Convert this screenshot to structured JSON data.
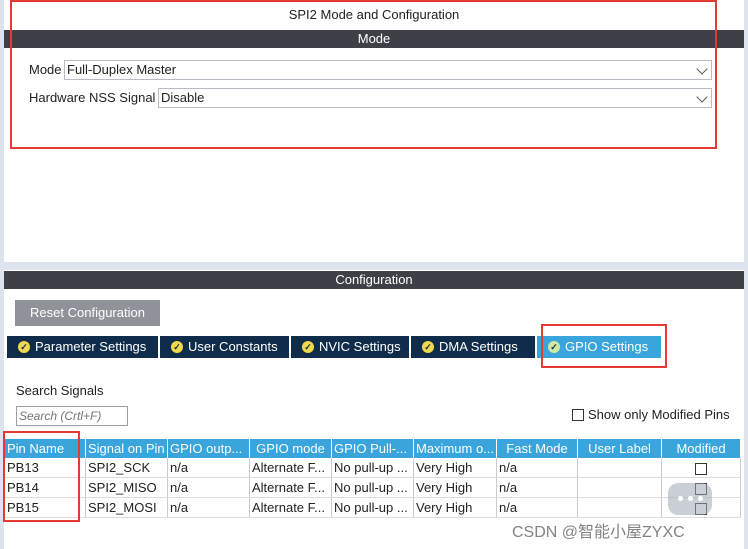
{
  "window": {
    "title": "SPI2 Mode and Configuration"
  },
  "mode_section": {
    "header": "Mode",
    "mode_label": "Mode",
    "mode_value": "Full-Duplex Master",
    "nss_label": "Hardware NSS Signal",
    "nss_value": "Disable"
  },
  "config_section": {
    "header": "Configuration",
    "reset_button": "Reset Configuration",
    "tabs": [
      {
        "label": "Parameter Settings"
      },
      {
        "label": "User Constants"
      },
      {
        "label": "NVIC Settings"
      },
      {
        "label": "DMA Settings"
      },
      {
        "label": "GPIO Settings",
        "active": true
      }
    ],
    "search_label": "Search Signals",
    "search_placeholder": "Search (Crtl+F)",
    "show_modified_label": "Show only Modified Pins",
    "table": {
      "columns": [
        "Pin Name",
        "Signal on Pin",
        "GPIO outp...",
        "GPIO mode",
        "GPIO Pull-...",
        "Maximum o...",
        "Fast Mode",
        "User Label",
        "Modified"
      ],
      "rows": [
        [
          "PB13",
          "SPI2_SCK",
          "n/a",
          "Alternate F...",
          "No pull-up ...",
          "Very High",
          "n/a",
          "",
          ""
        ],
        [
          "PB14",
          "SPI2_MISO",
          "n/a",
          "Alternate F...",
          "No pull-up ...",
          "Very High",
          "n/a",
          "",
          ""
        ],
        [
          "PB15",
          "SPI2_MOSI",
          "n/a",
          "Alternate F...",
          "No pull-up ...",
          "Very High",
          "n/a",
          "",
          ""
        ]
      ]
    }
  },
  "watermark": "CSDN @智能小屋ZYXC",
  "colors": {
    "header_bar": "#3d4047",
    "tab_dark": "#0f2d4a",
    "tab_active": "#39a5dc",
    "table_header": "#39a5dc",
    "highlight_box": "#e53935"
  }
}
